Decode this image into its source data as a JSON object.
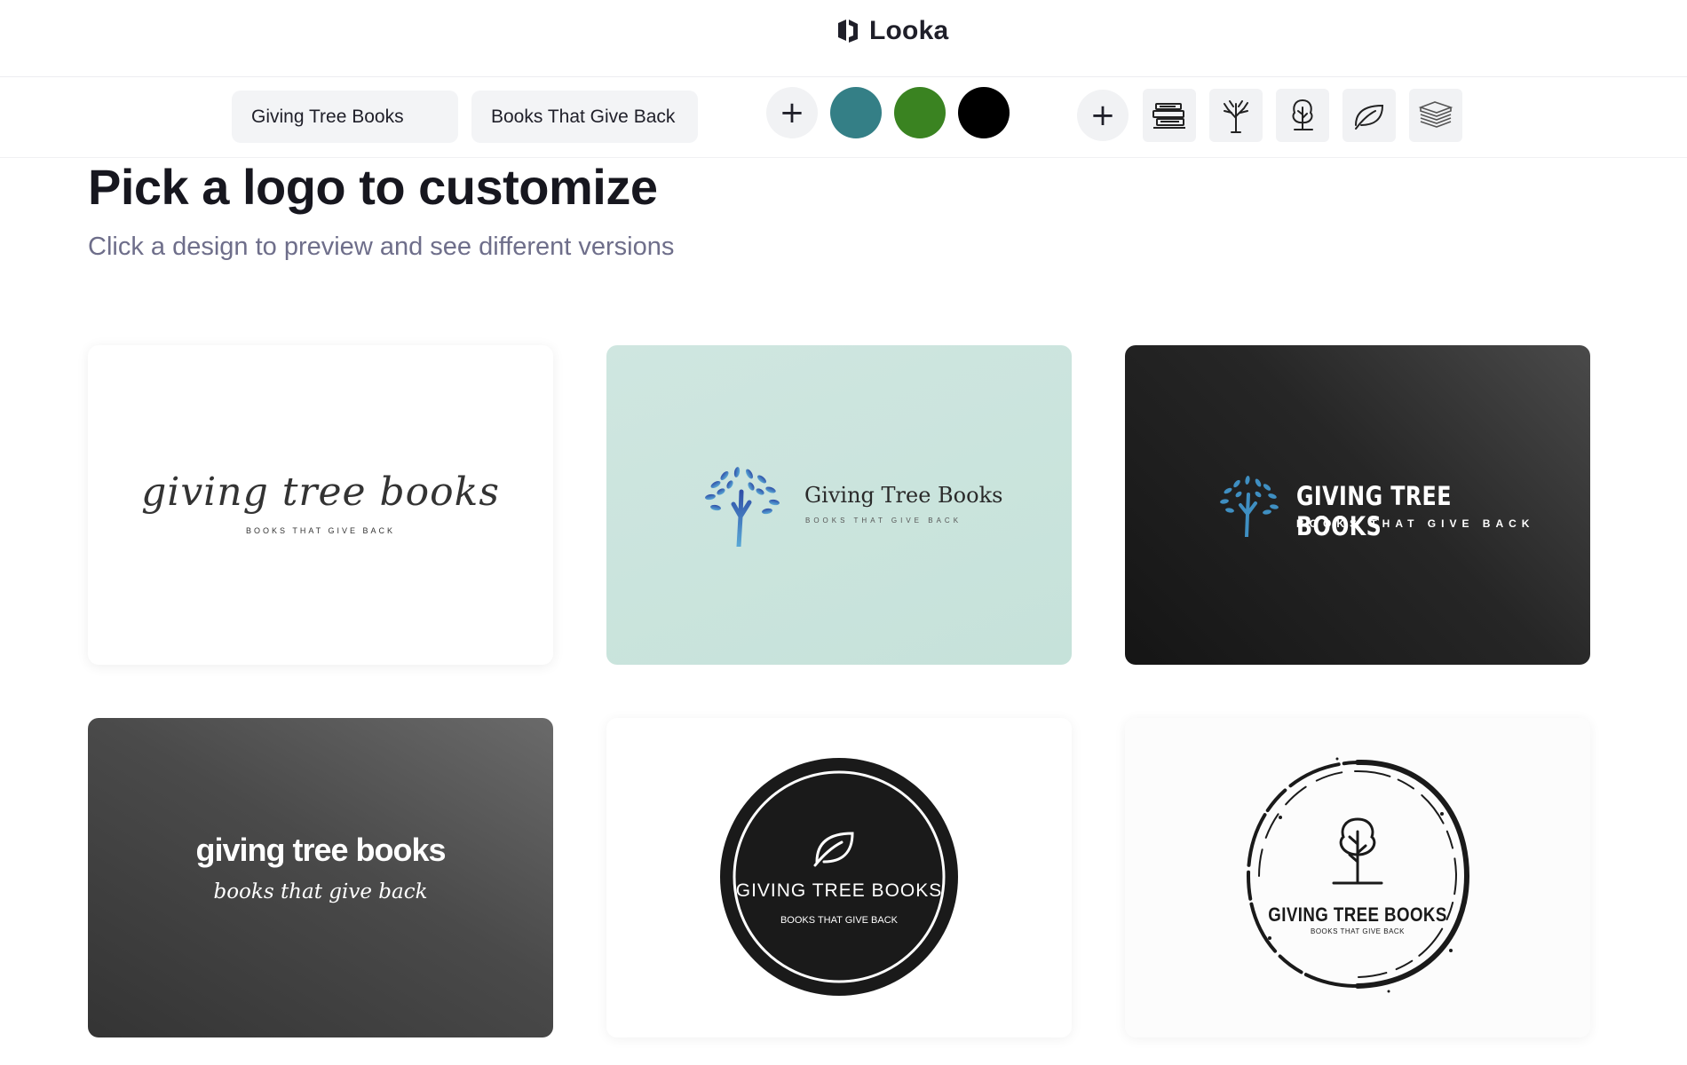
{
  "header": {
    "brand_name": "Looka"
  },
  "toolbar": {
    "company_name": "Giving Tree Books",
    "slogan": "Books That Give Back",
    "colors": [
      "#347f86",
      "#3a8321",
      "#000000"
    ],
    "icon_names": [
      "stacked-books-icon",
      "tree-icon",
      "outline-tree-icon",
      "leaf-icon",
      "book-stack-icon"
    ]
  },
  "main": {
    "title": "Pick a logo to customize",
    "subtitle": "Click a design to preview and see different versions"
  },
  "cards": [
    {
      "name": "giving tree books",
      "tagline": "BOOKS THAT GIVE BACK"
    },
    {
      "name": "Giving Tree Books",
      "tagline": "BOOKS THAT GIVE BACK"
    },
    {
      "name": "GIVING TREE BOOKS",
      "tagline": "BOOKS THAT GIVE BACK"
    },
    {
      "name": "giving tree books",
      "tagline": "books that give back"
    },
    {
      "name": "GIVING TREE BOOKS",
      "tagline": "BOOKS THAT GIVE BACK"
    },
    {
      "name": "GIVING TREE BOOKS",
      "tagline": "BOOKS THAT GIVE BACK"
    }
  ]
}
